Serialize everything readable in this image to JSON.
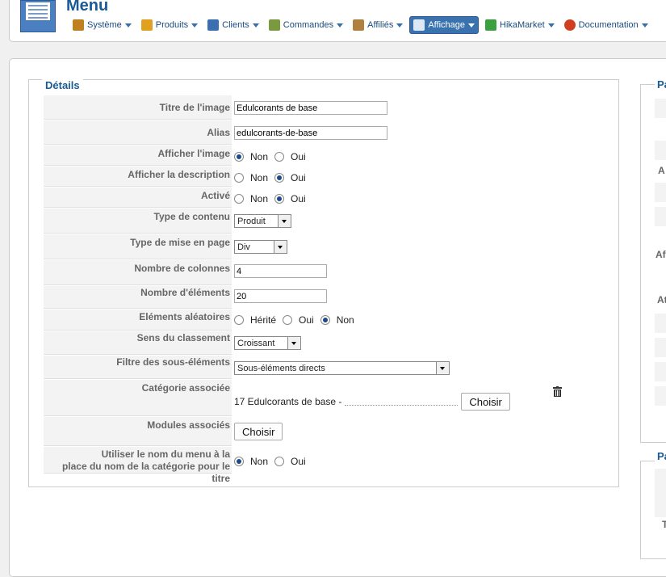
{
  "header": {
    "title": "Menu",
    "nav": [
      {
        "label": "Système",
        "icon": "tools-icon",
        "color": "#c08020"
      },
      {
        "label": "Produits",
        "icon": "box-icon",
        "color": "#e0a020"
      },
      {
        "label": "Clients",
        "icon": "users-icon",
        "color": "#3a6fb0"
      },
      {
        "label": "Commandes",
        "icon": "clipboard-icon",
        "color": "#7a9a40"
      },
      {
        "label": "Affiliés",
        "icon": "affiliates-icon",
        "color": "#b08040"
      },
      {
        "label": "Affichage",
        "icon": "display-icon",
        "color": "#ffffff",
        "active": true
      },
      {
        "label": "HikaMarket",
        "icon": "hikamarket-icon",
        "color": "#3aa040"
      },
      {
        "label": "Documentation",
        "icon": "lifebuoy-icon",
        "color": "#d04020"
      }
    ]
  },
  "details": {
    "legend": "Détails",
    "titre_label": "Titre de l'image",
    "titre_value": "Edulcorants de base",
    "alias_label": "Alias",
    "alias_value": "edulcorants-de-base",
    "afficher_image_label": "Afficher l'image",
    "afficher_desc_label": "Afficher la description",
    "active_label": "Activé",
    "non": "Non",
    "oui": "Oui",
    "herite": "Hérité",
    "type_contenu_label": "Type de contenu",
    "type_contenu_value": "Produit",
    "type_mise_label": "Type de mise en page",
    "type_mise_value": "Div",
    "nb_colonnes_label": "Nombre de colonnes",
    "nb_colonnes_value": "4",
    "nb_elements_label": "Nombre d'éléments",
    "nb_elements_value": "20",
    "aleatoires_label": "Eléments aléatoires",
    "sens_label": "Sens du classement",
    "sens_value": "Croissant",
    "filtre_label": "Filtre des sous-éléments",
    "filtre_value": "Sous-éléments directs",
    "categorie_label": "Catégorie associée",
    "categorie_value": "17 Edulcorants de base -",
    "choisir": "Choisir",
    "modules_label": "Modules associés",
    "utiliser_label_1": "Utiliser le nom du menu à la",
    "utiliser_label_2": "place du nom de la catégorie pour le titre"
  },
  "right_panel": {
    "legend1": "Pa",
    "legend2": "Pa",
    "labels": [
      "A",
      "Af",
      "At",
      "T"
    ]
  }
}
